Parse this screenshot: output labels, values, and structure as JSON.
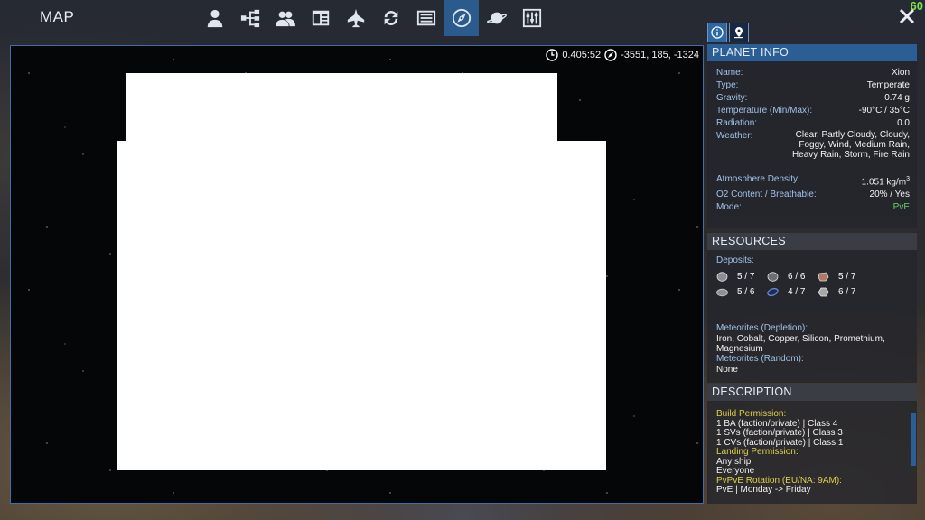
{
  "header": {
    "title": "MAP",
    "fps": "60",
    "nav": [
      {
        "name": "player-icon"
      },
      {
        "name": "tech-tree-icon"
      },
      {
        "name": "faction-icon"
      },
      {
        "name": "registry-icon"
      },
      {
        "name": "ship-icon"
      },
      {
        "name": "trade-icon"
      },
      {
        "name": "log-icon"
      },
      {
        "name": "compass-icon",
        "active": true
      },
      {
        "name": "planet-icon"
      },
      {
        "name": "settings-sliders-icon"
      }
    ]
  },
  "map": {
    "time": "0.405:52",
    "coords": "-3551, 185, -1324"
  },
  "planet_info": {
    "title": "PLANET INFO",
    "rows": {
      "name": {
        "label": "Name:",
        "value": "Xion"
      },
      "type": {
        "label": "Type:",
        "value": "Temperate"
      },
      "gravity": {
        "label": "Gravity:",
        "value": "0.74 g"
      },
      "temperature": {
        "label": "Temperature (Min/Max):",
        "value": "-90°C / 35°C"
      },
      "radiation": {
        "label": "Radiation:",
        "value": "0.0"
      },
      "weather": {
        "label": "Weather:",
        "value": "Clear, Partly Cloudy, Cloudy, Foggy, Wind, Medium Rain, Heavy Rain, Storm, Fire Rain"
      },
      "atmosphere": {
        "label": "Atmosphere Density:",
        "value": "1.051 kg/m",
        "unit_sup": "3"
      },
      "o2": {
        "label": "O2 Content / Breathable:",
        "value": "20% / Yes"
      },
      "mode": {
        "label": "Mode:",
        "value": "PvE"
      }
    }
  },
  "resources": {
    "title": "RESOURCES",
    "deposits_label": "Deposits:",
    "deposits": [
      {
        "icon": "iron-ore-icon",
        "value": "5 / 7",
        "color": "#8a8f94"
      },
      {
        "icon": "cobalt-ore-icon",
        "value": "6 / 6",
        "color": "#9a9a9a"
      },
      {
        "icon": "copper-ore-icon",
        "value": "5 / 7",
        "color": "#b07a62"
      },
      {
        "icon": "silicon-ore-icon",
        "value": "5 / 6",
        "color": "#8d9096"
      },
      {
        "icon": "promethium-ore-icon",
        "value": "4 / 7",
        "color": "#6a8de0"
      },
      {
        "icon": "magnesium-ore-icon",
        "value": "6 / 7",
        "color": "#a7a7a7"
      }
    ],
    "meteorites_depletion_label": "Meteorites (Depletion):",
    "meteorites_depletion_value": "Iron, Cobalt, Copper, Silicon, Promethium, Magnesium",
    "meteorites_random_label": "Meteorites (Random):",
    "meteorites_random_value": "None"
  },
  "description": {
    "title": "DESCRIPTION",
    "build_label": "Build Permission:",
    "build_lines": [
      "1 BA (faction/private) | Class 4",
      "1 SVs (faction/private) | Class 3",
      "1 CVs (faction/private) | Class 1"
    ],
    "landing_label": "Landing Permission:",
    "landing_lines": [
      "Any ship",
      "Everyone"
    ],
    "rotation_label": "PvPvE Rotation (EU/NA: 9AM):",
    "rotation_lines": [
      "PvE | Monday -> Friday"
    ]
  },
  "colors": {
    "accent": "#2c5e96",
    "label": "#9ec2ea",
    "mode_pve": "#64d264",
    "desc_label": "#e0d24a",
    "fps": "#7fe04a"
  }
}
